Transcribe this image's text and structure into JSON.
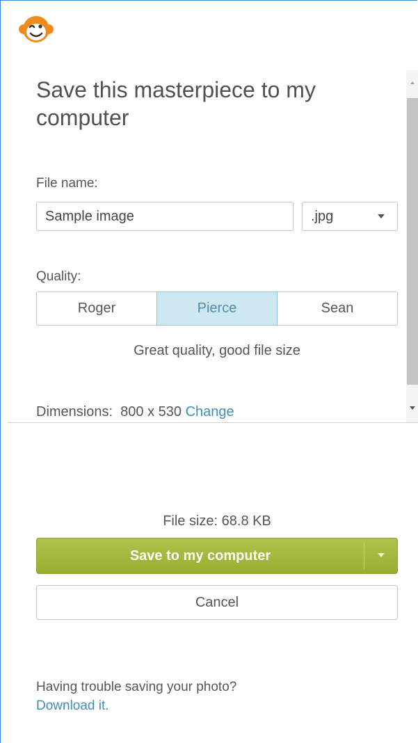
{
  "dialog": {
    "logo_icon": "monkey-logo-icon",
    "title": "Save this masterpiece to my computer",
    "file_name": {
      "label": "File name:",
      "value": "Sample image",
      "format": ".jpg"
    },
    "quality": {
      "label": "Quality:",
      "options": [
        "Roger",
        "Pierce",
        "Sean"
      ],
      "selected": "Pierce",
      "description": "Great quality, good file size"
    },
    "dimensions": {
      "label": "Dimensions:",
      "value": "800 x 530",
      "change_link": "Change"
    },
    "file_size": "File size: 68.8 KB",
    "save_button": "Save to my computer",
    "cancel_button": "Cancel",
    "trouble_text": "Having trouble saving your photo?",
    "download_link": "Download it."
  },
  "colors": {
    "accent_green": "#a3b83c",
    "link_blue": "#3d8fb8",
    "selected_bg": "#cde8f1",
    "logo_orange": "#f08a1d"
  }
}
